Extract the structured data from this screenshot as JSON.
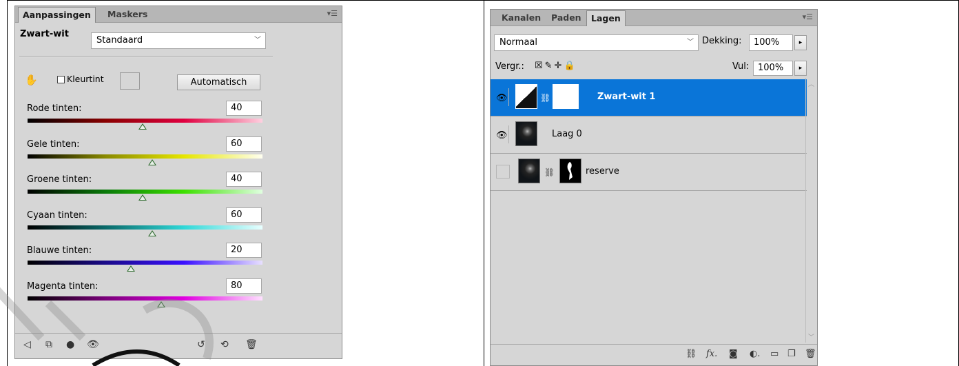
{
  "adjustments_panel": {
    "tabs": [
      "Aanpassingen",
      "Maskers"
    ],
    "active_tab": "Aanpassingen",
    "preset_label": "Zwart-wit",
    "preset_value": "Standaard",
    "tint_label": "Kleurtint",
    "auto_button": "Automatisch",
    "sliders": [
      {
        "label": "Rode tinten:",
        "value": "40",
        "colors": [
          "#000000",
          "#8a0000",
          "#e00040",
          "#ffd0e0"
        ],
        "thumb": 0.49
      },
      {
        "label": "Gele tinten:",
        "value": "60",
        "colors": [
          "#000000",
          "#8a8a00",
          "#e6e600",
          "#fffff0"
        ],
        "thumb": 0.53
      },
      {
        "label": "Groene tinten:",
        "value": "40",
        "colors": [
          "#000000",
          "#0a7a0a",
          "#3de000",
          "#e0ffe0"
        ],
        "thumb": 0.49
      },
      {
        "label": "Cyaan tinten:",
        "value": "60",
        "colors": [
          "#000000",
          "#0a6a6a",
          "#30d8d8",
          "#e8ffff"
        ],
        "thumb": 0.53
      },
      {
        "label": "Blauwe tinten:",
        "value": "20",
        "colors": [
          "#000000",
          "#1a0a8a",
          "#3a10ff",
          "#e8e0ff"
        ],
        "thumb": 0.44
      },
      {
        "label": "Magenta tinten:",
        "value": "80",
        "colors": [
          "#000000",
          "#7a007a",
          "#e000e0",
          "#ffe0ff"
        ],
        "thumb": 0.57
      }
    ],
    "bottom_icons": [
      "back-arrow-icon",
      "clip-layer-icon",
      "mask-toggle-icon",
      "visibility-eye-icon",
      "view-previous-icon",
      "reset-icon",
      "delete-icon"
    ]
  },
  "layers_panel": {
    "tabs": [
      "Kanalen",
      "Paden",
      "Lagen"
    ],
    "active_tab": "Lagen",
    "blend_mode": "Normaal",
    "opacity_label": "Dekking:",
    "opacity_value": "100%",
    "lock_label": "Vergr.:",
    "fill_label": "Vul:",
    "fill_value": "100%",
    "layers": [
      {
        "name": "Zwart-wit 1",
        "visible": true,
        "selected": true
      },
      {
        "name": "Laag 0",
        "visible": true,
        "selected": false
      },
      {
        "name": "reserve",
        "visible": false,
        "selected": false
      }
    ],
    "bottom_icons": [
      "link-icon",
      "fx-icon",
      "add-mask-icon",
      "adjustment-icon",
      "group-icon",
      "new-layer-icon",
      "delete-icon"
    ]
  },
  "accent": "#0a75d8"
}
